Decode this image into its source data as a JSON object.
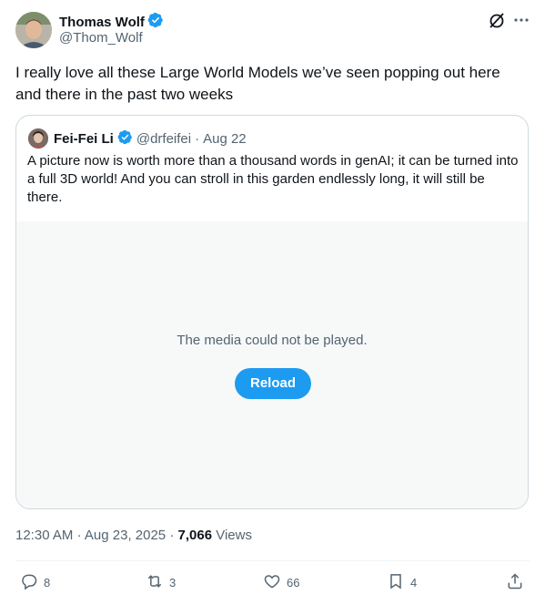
{
  "author": {
    "name": "Thomas Wolf",
    "handle": "@Thom_Wolf",
    "verified": true
  },
  "tweet": {
    "text": "I really love all these Large World Models we’ve seen popping out here and there in the past two weeks"
  },
  "quoted": {
    "name": "Fei-Fei Li",
    "handle": "@drfeifei",
    "separator": "·",
    "date": "Aug 22",
    "text": "A picture now is worth more than a thousand words in genAI; it can be turned into a full 3D world! And you can stroll in this garden endlessly long, it will still be there.",
    "media_message": "The media could not be played.",
    "reload_label": "Reload"
  },
  "meta": {
    "time": "12:30 AM",
    "sep1": "·",
    "date": "Aug 23, 2025",
    "sep2": "·",
    "views_count": "7,066",
    "views_label": "Views"
  },
  "actions": {
    "replies": "8",
    "reposts": "3",
    "likes": "66",
    "bookmarks": "4"
  },
  "icons": [
    "grok-icon",
    "more-icon",
    "verified-badge-icon",
    "reply-icon",
    "repost-icon",
    "like-icon",
    "bookmark-icon",
    "share-icon"
  ],
  "colors": {
    "accent": "#1d9bf0",
    "text": "#0f1419",
    "muted": "#536471",
    "border": "#cfd9de",
    "media_bg": "#f7f9f9"
  }
}
